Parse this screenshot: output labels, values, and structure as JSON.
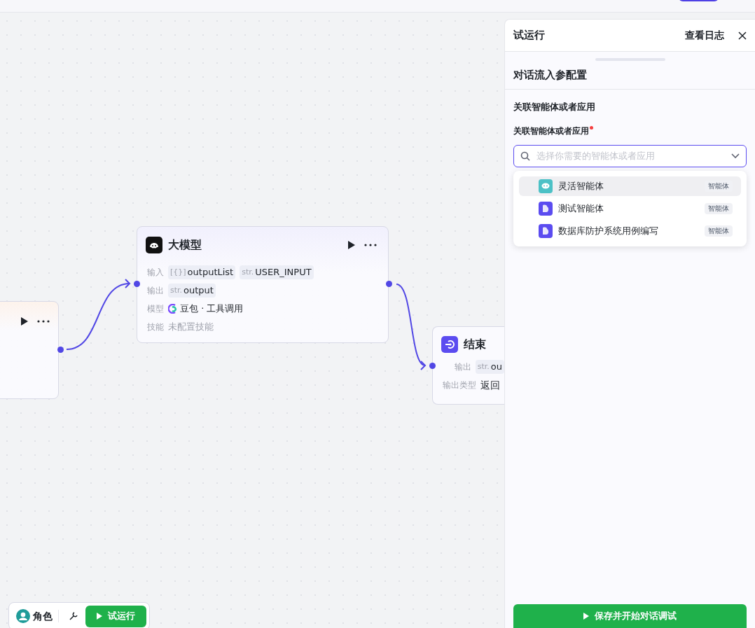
{
  "canvas": {
    "llm_node": {
      "title": "大模型",
      "rows": [
        {
          "label": "输入",
          "kind": "tags",
          "tags": [
            {
              "type": "[{}]",
              "name": "outputList"
            },
            {
              "type": "str.",
              "name": "USER_INPUT"
            }
          ]
        },
        {
          "label": "输出",
          "kind": "tags",
          "tags": [
            {
              "type": "str.",
              "name": "output"
            }
          ]
        },
        {
          "label": "模型",
          "kind": "model",
          "value": "豆包 · 工具调用"
        },
        {
          "label": "技能",
          "kind": "muted",
          "value": "未配置技能"
        }
      ]
    },
    "end_node": {
      "title": "结束",
      "rows": [
        {
          "label": "输出",
          "kind": "tags",
          "tags": [
            {
              "type": "str.",
              "name": "ou"
            }
          ]
        },
        {
          "label": "输出类型",
          "kind": "text",
          "value": "返回"
        }
      ]
    }
  },
  "toolbar": {
    "role_button": "角色",
    "run_button": "试运行"
  },
  "panel": {
    "title": "试运行",
    "log_link": "查看日志",
    "section_title": "对话流入参配置",
    "group_title": "关联智能体或者应用",
    "field_label": "关联智能体或者应用",
    "required": true,
    "select": {
      "placeholder": "选择你需要的智能体或者应用"
    },
    "options": [
      {
        "kind": "chat",
        "label": "灵活智能体",
        "tag": "智能体",
        "selected": true
      },
      {
        "kind": "bot",
        "label": "测试智能体",
        "tag": "智能体",
        "selected": false
      },
      {
        "kind": "bot",
        "label": "数据库防护系统用例编写",
        "tag": "智能体",
        "selected": false
      }
    ],
    "submit_button": "保存并开始对话调试"
  }
}
